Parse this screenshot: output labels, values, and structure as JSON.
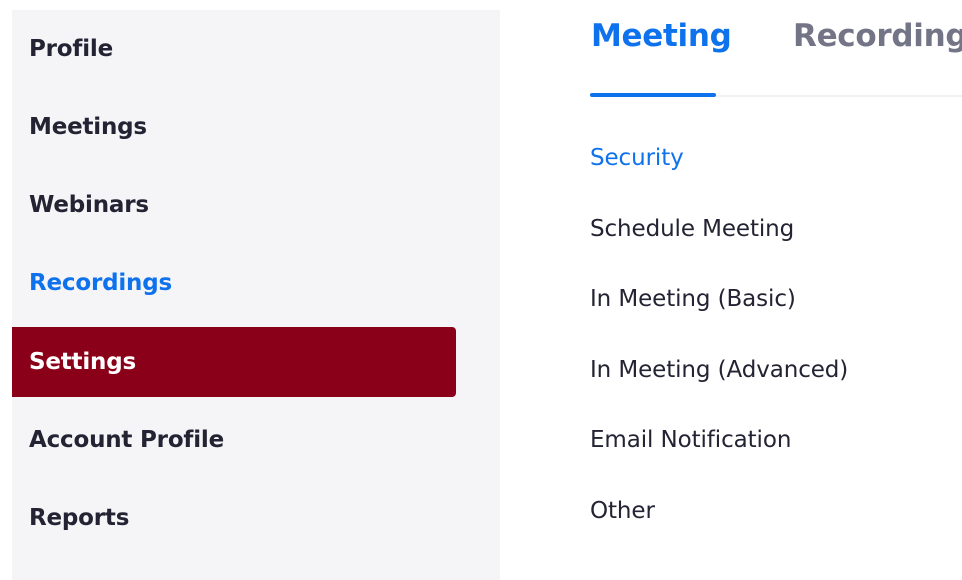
{
  "sidebar": {
    "items": [
      {
        "label": "Profile"
      },
      {
        "label": "Meetings"
      },
      {
        "label": "Webinars"
      },
      {
        "label": "Recordings"
      },
      {
        "label": "Settings"
      },
      {
        "label": "Account Profile"
      },
      {
        "label": "Reports"
      }
    ]
  },
  "tabs": [
    {
      "label": "Meeting"
    },
    {
      "label": "Recording"
    }
  ],
  "sections": [
    {
      "label": "Security"
    },
    {
      "label": "Schedule Meeting"
    },
    {
      "label": "In Meeting (Basic)"
    },
    {
      "label": "In Meeting (Advanced)"
    },
    {
      "label": "Email Notification"
    },
    {
      "label": "Other"
    }
  ],
  "colors": {
    "accent": "#0e72ed",
    "active_nav": "#8a0019",
    "sidebar_bg": "#f5f5f8",
    "text": "#232333",
    "inactive_tab": "#747487"
  }
}
